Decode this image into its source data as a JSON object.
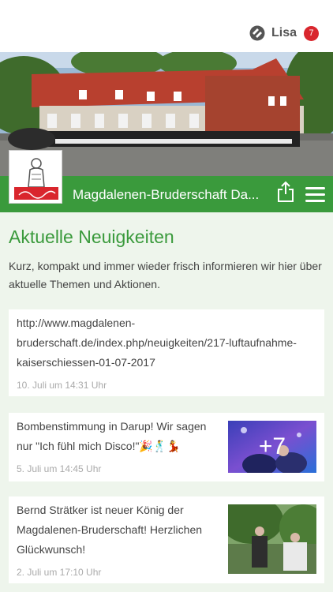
{
  "topbar": {
    "user_name": "Lisa",
    "notification_count": "7"
  },
  "app": {
    "title": "Magdalenen-Bruderschaft Da..."
  },
  "section": {
    "title": "Aktuelle Neuigkeiten",
    "description": "Kurz, kompakt und immer wieder frisch informieren wir hier über aktuelle Themen und Aktionen."
  },
  "posts": [
    {
      "text_lines": [
        "http://www.magdalenen-",
        "bruderschaft.de/index.php/neuigkeiten/217-luftaufnahme-",
        "kaiserschiessen-01-07-2017"
      ],
      "date": "10. Juli um 14:31 Uhr"
    },
    {
      "text_lines": [
        "Bombenstimmung in Darup! Wir sagen",
        "nur \"Ich fühl mich Disco!\"🎉🕺💃"
      ],
      "date": "5. Juli um 14:45 Uhr",
      "more_images": "+7"
    },
    {
      "text_lines": [
        "Bernd Strätker ist neuer König der",
        "Magdalenen-Bruderschaft! Herzlichen",
        "Glückwunsch!"
      ],
      "date": "2. Juli um 17:10 Uhr"
    }
  ],
  "colors": {
    "brand_green": "#3a9a3c",
    "badge_red": "#d9262d"
  },
  "icons": [
    "app-logo-icon",
    "share-icon",
    "hamburger-menu-icon"
  ]
}
